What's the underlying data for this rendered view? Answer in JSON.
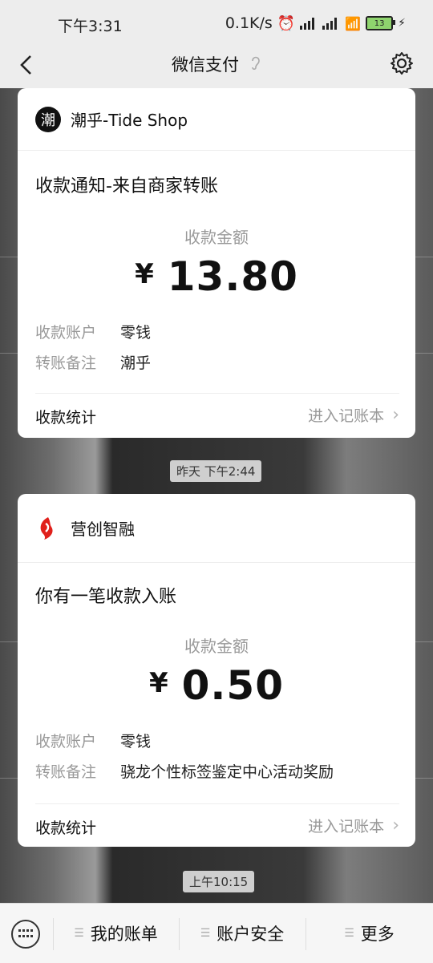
{
  "status": {
    "time": "下午3:31",
    "net_speed": "0.1K/s",
    "battery": "13"
  },
  "nav": {
    "title": "微信支付"
  },
  "messages": [
    {
      "merchant": "潮乎-Tide Shop",
      "logo_text": "潮",
      "title": "收款通知-来自商家转账",
      "amount_label": "收款金额",
      "currency": "¥",
      "amount": "13.80",
      "account_key": "收款账户",
      "account_value": "零钱",
      "note_key": "转账备注",
      "note_value": "潮乎",
      "stats_label": "收款统计",
      "ledger_link": "进入记账本"
    },
    {
      "merchant": "营创智融",
      "title": "你有一笔收款入账",
      "amount_label": "收款金额",
      "currency": "¥",
      "amount": "0.50",
      "account_key": "收款账户",
      "account_value": "零钱",
      "note_key": "转账备注",
      "note_value": "骁龙个性标签鉴定中心活动奖励",
      "stats_label": "收款统计",
      "ledger_link": "进入记账本"
    }
  ],
  "timestamps": [
    "昨天 下午2:44",
    "上午10:15"
  ],
  "bottom_menu": {
    "bills": "我的账单",
    "security": "账户安全",
    "more": "更多"
  }
}
